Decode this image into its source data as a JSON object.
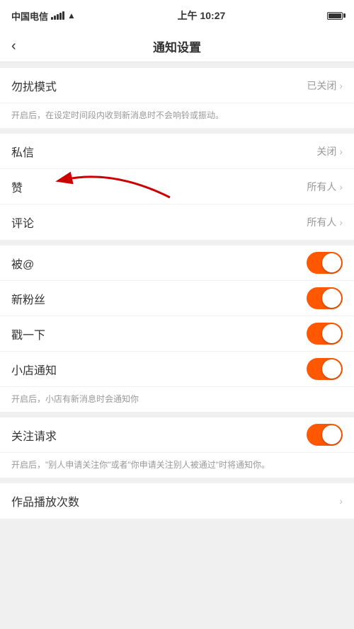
{
  "statusBar": {
    "carrier": "中国电信",
    "wifi": "WiFi",
    "time": "上午 10:27",
    "battery": "full"
  },
  "nav": {
    "back": "‹",
    "title": "通知设置"
  },
  "sections": [
    {
      "id": "do-not-disturb",
      "rows": [
        {
          "label": "勿扰模式",
          "value": "已关闭",
          "type": "chevron"
        }
      ],
      "hint": "开启后，在设定时间段内收到新消息时不会响铃或振动。"
    },
    {
      "id": "privacy",
      "rows": [
        {
          "label": "私信",
          "value": "关闭",
          "type": "chevron"
        },
        {
          "label": "赞",
          "value": "所有人",
          "type": "chevron",
          "annotated": true
        },
        {
          "label": "评论",
          "value": "所有人",
          "type": "chevron"
        }
      ]
    },
    {
      "id": "toggles",
      "rows": [
        {
          "label": "被@",
          "type": "toggle",
          "enabled": true
        },
        {
          "label": "新粉丝",
          "type": "toggle",
          "enabled": true
        },
        {
          "label": "戳一下",
          "type": "toggle",
          "enabled": true
        },
        {
          "label": "小店通知",
          "type": "toggle",
          "enabled": true,
          "hint": "开启后，小店有新消息时会通知你"
        }
      ]
    },
    {
      "id": "follow",
      "rows": [
        {
          "label": "关注请求",
          "type": "toggle",
          "enabled": true,
          "hint": "开启后，\"别人申请关注你\"或者\"你申请关注别人被通过\"时将通知你。"
        }
      ]
    },
    {
      "id": "plays",
      "rows": [
        {
          "label": "作品播放次数",
          "type": "chevron-only"
        }
      ]
    }
  ]
}
